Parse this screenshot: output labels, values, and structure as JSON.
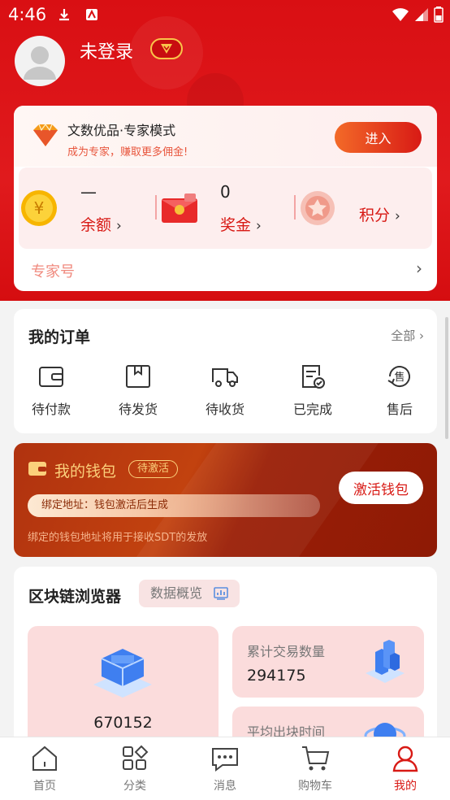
{
  "status_bar": {
    "time": "4:46"
  },
  "profile": {
    "username": "未登录"
  },
  "expert_banner": {
    "title": "文数优品·专家模式",
    "subtitle": "成为专家，赚取更多佣金!",
    "enter_label": "进入"
  },
  "assets": [
    {
      "value": "—",
      "label": "余额",
      "icon": "coin-icon"
    },
    {
      "value": "0",
      "label": "奖金",
      "icon": "red-envelope-icon"
    },
    {
      "value": "",
      "label": "积分",
      "icon": "points-star-icon"
    }
  ],
  "expert_no": {
    "label": "专家号"
  },
  "orders": {
    "title": "我的订单",
    "all_label": "全部",
    "items": [
      {
        "label": "待付款",
        "icon": "wallet-icon"
      },
      {
        "label": "待发货",
        "icon": "package-icon"
      },
      {
        "label": "待收货",
        "icon": "truck-icon"
      },
      {
        "label": "已完成",
        "icon": "completed-doc-icon"
      },
      {
        "label": "售后",
        "icon": "after-sale-icon"
      }
    ]
  },
  "wallet": {
    "title": "我的钱包",
    "status": "待激活",
    "address_line": "绑定地址：钱包激活后生成",
    "note": "绑定的钱包地址将用于接收SDT的发放",
    "activate_label": "激活钱包"
  },
  "blockchain": {
    "title": "区块链浏览器",
    "overview_label": "数据概览",
    "block_height_value": "670152",
    "tx_count_label": "累计交易数量",
    "tx_count_value": "294175",
    "avg_block_time_label": "平均出块时间"
  },
  "tabbar": {
    "items": [
      {
        "label": "首页",
        "icon": "home-icon",
        "active": false
      },
      {
        "label": "分类",
        "icon": "category-icon",
        "active": false
      },
      {
        "label": "消息",
        "icon": "message-icon",
        "active": false
      },
      {
        "label": "购物车",
        "icon": "cart-icon",
        "active": false
      },
      {
        "label": "我的",
        "icon": "profile-icon",
        "active": true
      }
    ]
  },
  "colors": {
    "brand_red": "#d81a15",
    "gold": "#fbd07b",
    "wallet_brown": "#b0320f"
  }
}
